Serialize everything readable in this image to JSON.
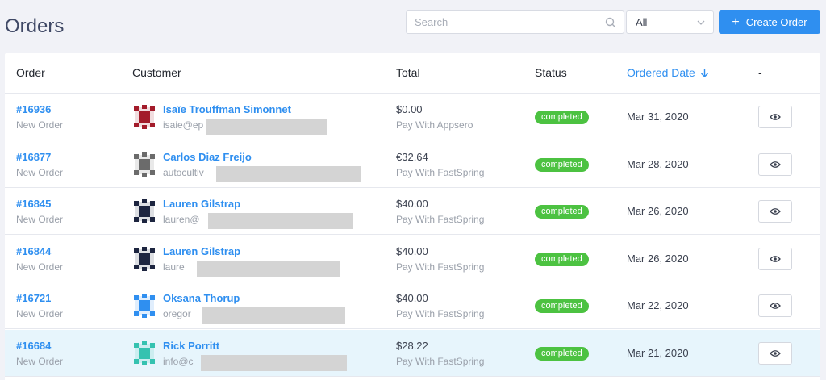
{
  "page": {
    "title": "Orders"
  },
  "toolbar": {
    "search_placeholder": "Search",
    "search_value": "",
    "filter_value": "All",
    "create_label": "Create Order"
  },
  "table": {
    "headers": {
      "order": "Order",
      "customer": "Customer",
      "total": "Total",
      "status": "Status",
      "date": "Ordered Date",
      "actions": "-"
    },
    "rows": [
      {
        "id": "#16936",
        "type": "New Order",
        "name": "Isaïe Trouffman Simonnet",
        "email": "isaie@ep",
        "total": "$0.00",
        "method": "Pay With Appsero",
        "status": "completed",
        "date": "Mar 31, 2020",
        "avatar": "red-pattern-avatar",
        "avatar_color": "#a31b2a"
      },
      {
        "id": "#16877",
        "type": "New Order",
        "name": "Carlos Diaz Freijo",
        "email": "autocultiv",
        "total": "€32.64",
        "method": "Pay With FastSpring",
        "status": "completed",
        "date": "Mar 28, 2020",
        "avatar": "skull-avatar",
        "avatar_color": "#6b6b6b"
      },
      {
        "id": "#16845",
        "type": "New Order",
        "name": "Lauren Gilstrap",
        "email": "lauren@",
        "total": "$40.00",
        "method": "Pay With FastSpring",
        "status": "completed",
        "date": "Mar 26, 2020",
        "avatar": "navy-pattern-avatar",
        "avatar_color": "#1d2540"
      },
      {
        "id": "#16844",
        "type": "New Order",
        "name": "Lauren Gilstrap",
        "email": "laure",
        "total": "$40.00",
        "method": "Pay With FastSpring",
        "status": "completed",
        "date": "Mar 26, 2020",
        "avatar": "navy-pattern-avatar",
        "avatar_color": "#1d2540"
      },
      {
        "id": "#16721",
        "type": "New Order",
        "name": "Oksana Thorup",
        "email": "oregor",
        "total": "$40.00",
        "method": "Pay With FastSpring",
        "status": "completed",
        "date": "Mar 22, 2020",
        "avatar": "blue-pattern-avatar",
        "avatar_color": "#2f8ff0"
      },
      {
        "id": "#16684",
        "type": "New Order",
        "name": "Rick Porritt",
        "email": "info@c",
        "total": "$28.22",
        "method": "Pay With FastSpring",
        "status": "completed",
        "date": "Mar 21, 2020",
        "avatar": "teal-pattern-avatar",
        "avatar_color": "#35c2b0"
      }
    ]
  },
  "colors": {
    "accent": "#2f8ff0",
    "status_completed": "#4cc241",
    "highlight_row": "#e7f5fc"
  },
  "icons": {
    "search": "search-icon",
    "chevron": "chevron-down-icon",
    "plus": "plus-icon",
    "sort": "arrow-down-icon",
    "view": "eye-icon"
  }
}
